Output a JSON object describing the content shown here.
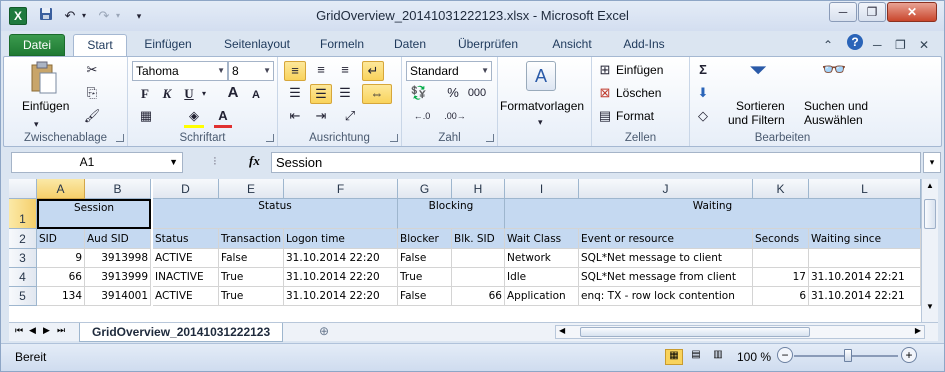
{
  "title_bar": {
    "title": "GridOverview_20141031222123.xlsx  -  Microsoft Excel",
    "app_icon": "X",
    "qat_save_icon": "floppy-disk",
    "qat_undo_icon": "↶",
    "qat_redo_icon": "↷",
    "qat_customize_icon": "▾",
    "win_min": "─",
    "win_max": "❐",
    "win_close": "✕"
  },
  "tabs": [
    "Datei",
    "Start",
    "Einfügen",
    "Seitenlayout",
    "Formeln",
    "Daten",
    "Überprüfen",
    "Ansicht",
    "Add-Ins"
  ],
  "ribbon": {
    "clipboard": {
      "label": "Zwischenablage",
      "paste": "Einfügen"
    },
    "font": {
      "label": "Schriftart",
      "name": "Tahoma",
      "size": "8",
      "bold": "F",
      "italic": "K",
      "underline": "U",
      "grow": "A",
      "shrink": "A",
      "fill_letter": "A"
    },
    "alignment": {
      "label": "Ausrichtung"
    },
    "number": {
      "label": "Zahl",
      "format": "Standard",
      "percent": "%",
      "thousands": "000"
    },
    "styles": {
      "label": "Formatvorlagen",
      "letter": "A"
    },
    "cells": {
      "label": "Zellen",
      "insert": "Einfügen",
      "delete": "Löschen",
      "format": "Format"
    },
    "editing": {
      "label": "Bearbeiten",
      "sum": "Σ",
      "sort_line1": "Sortieren",
      "sort_line2": "und Filtern",
      "find_line1": "Suchen und",
      "find_line2": "Auswählen"
    }
  },
  "formula_bar": {
    "name_box": "A1",
    "fx": "fx",
    "value": "Session"
  },
  "grid": {
    "columns": [
      "A",
      "B",
      "C",
      "D",
      "E",
      "F",
      "G",
      "H",
      "I",
      "J",
      "K",
      "L"
    ],
    "rows": [
      "1",
      "2",
      "3",
      "4",
      "5"
    ],
    "group_headers": {
      "session": "Session",
      "status": "Status",
      "blocking": "Blocking",
      "waiting": "Waiting"
    },
    "headers": [
      "SID",
      "Aud SID",
      "Status",
      "Transaction",
      "Logon time",
      "Blocker",
      "Blk. SID",
      "Wait Class",
      "Event or resource",
      "Seconds",
      "Waiting since"
    ],
    "data": [
      [
        "9",
        "3913998",
        "ACTIVE",
        "False",
        "31.10.2014 22:20",
        "False",
        "",
        "Network",
        "SQL*Net message to client",
        "",
        ""
      ],
      [
        "66",
        "3913999",
        "INACTIVE",
        "True",
        "31.10.2014 22:20",
        "True",
        "",
        "Idle",
        "SQL*Net message from client",
        "17",
        "31.10.2014 22:21"
      ],
      [
        "134",
        "3914001",
        "ACTIVE",
        "True",
        "31.10.2014 22:20",
        "False",
        "66",
        "Application",
        "enq: TX - row lock contention",
        "6",
        "31.10.2014 22:21"
      ]
    ]
  },
  "sheet_tabs": {
    "active": "GridOverview_20141031222123",
    "nav": [
      "⏮",
      "◀",
      "▶",
      "⏭"
    ]
  },
  "status_bar": {
    "ready": "Bereit",
    "zoom": "100 %",
    "zoom_level_percent": 100
  }
}
